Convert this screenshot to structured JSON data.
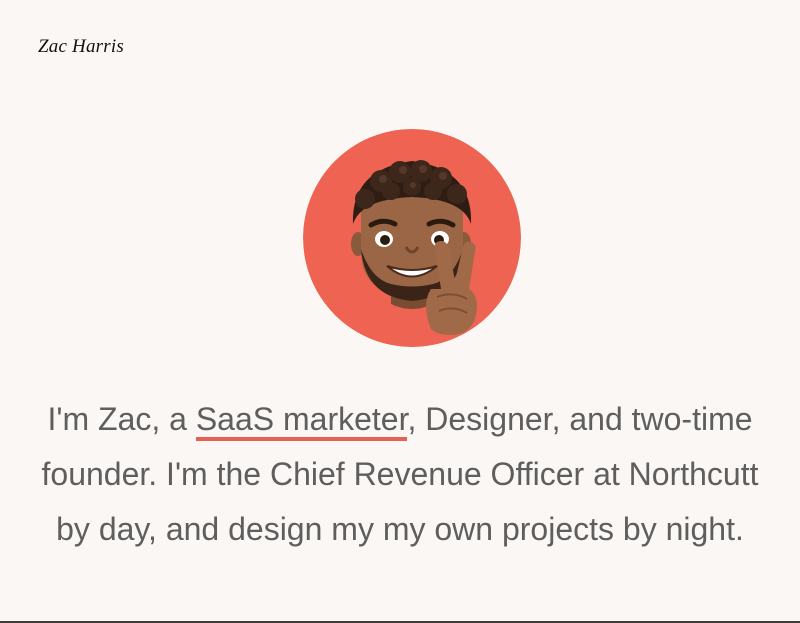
{
  "site": {
    "name": "Zac Harris"
  },
  "avatar": {
    "icon": "memoji-peace-sign-icon",
    "background_color": "#ee6352"
  },
  "intro": {
    "lead": "I'm Zac, a ",
    "link_text": "SaaS marketer",
    "rest": ", Designer, and two-time founder. I'm the Chief Revenue Officer at Northcutt by day, and design my my own projects by night."
  },
  "colors": {
    "page_background": "#faf7f4",
    "body_text": "#5e5e5e",
    "accent_underline": "#e86150"
  }
}
